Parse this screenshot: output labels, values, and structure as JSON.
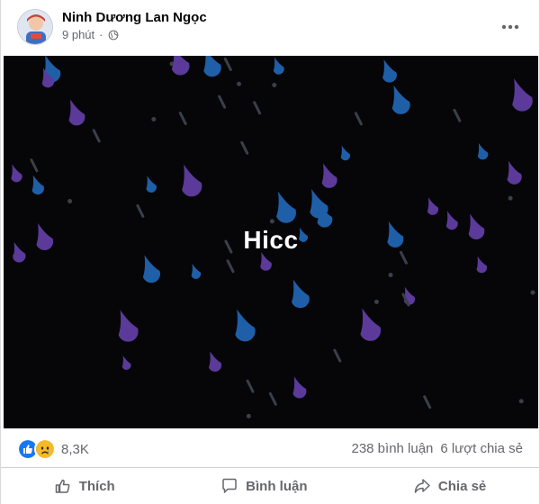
{
  "post": {
    "author": "Ninh Dương Lan Ngọc",
    "time": "9 phút",
    "privacy_icon": "globe-icon",
    "more_icon": "more-icon"
  },
  "media": {
    "caption": "Hicc",
    "background": "#060608",
    "drop_colors": [
      "#5b3a9a",
      "#1f5fa8",
      "#3a3f4a"
    ]
  },
  "stats": {
    "reaction_icons": [
      "like-icon",
      "sad-icon"
    ],
    "reaction_count": "8,3K",
    "comments": "238 bình luận",
    "shares": "6 lượt chia sẻ"
  },
  "actions": {
    "like": "Thích",
    "comment": "Bình luận",
    "share": "Chia sẻ"
  },
  "colors": {
    "like_blue": "#1877f2",
    "sad_yellow": "#f7b928",
    "secondary_text": "#65676b"
  }
}
